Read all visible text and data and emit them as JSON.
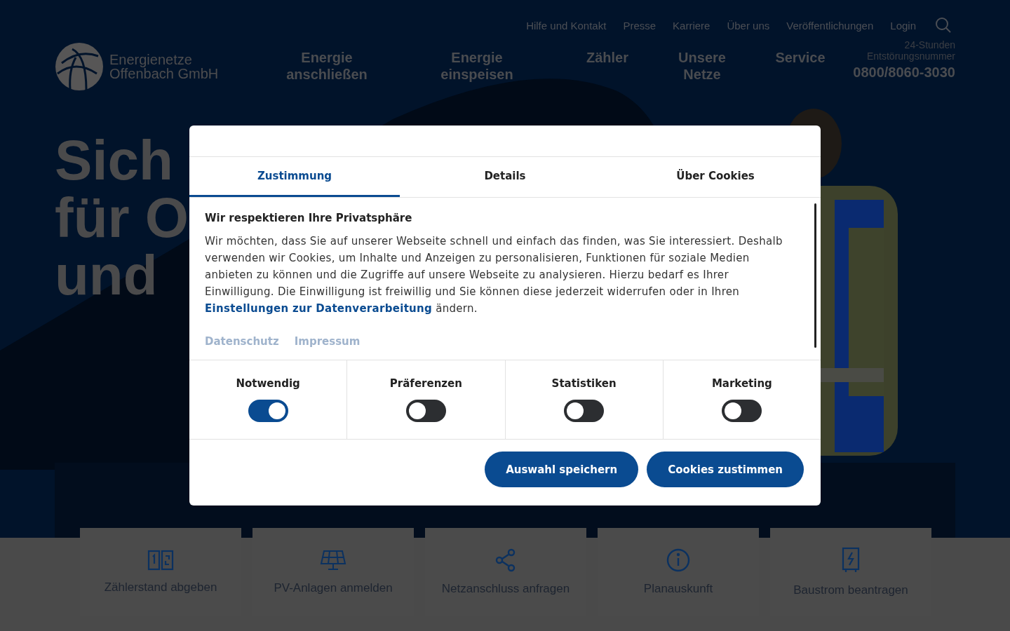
{
  "top_links": [
    "Hilfe und Kontakt",
    "Presse",
    "Karriere",
    "Über uns",
    "Veröffentlichungen",
    "Login"
  ],
  "logo": {
    "line1": "Energienetze",
    "line2": "Offenbach GmbH"
  },
  "main_nav": [
    "Energie anschließen",
    "Energie einspeisen",
    "Zähler",
    "Unsere Netze",
    "Service"
  ],
  "hotline": {
    "label_1": "24-Stunden",
    "label_2": "Entstörungsnummer",
    "number": "0800/8060-3030"
  },
  "hero": {
    "lines": [
      "Sich",
      "für O",
      "und"
    ],
    "picture": {
      "kind": "picture"
    }
  },
  "quick_links": [
    "Zählerstand abgeben",
    "PV-Anlagen anmelden",
    "Netzanschluss anfragen",
    "Planauskunft",
    "Baustrom beantragen"
  ],
  "cookie_dialog": {
    "tabs": [
      {
        "label": "Zustimmung",
        "selected": true
      },
      {
        "label": "Details",
        "selected": false
      },
      {
        "label": "Über Cookies",
        "selected": false
      }
    ],
    "heading": "Wir respektieren Ihre Privatsphäre",
    "text_before": "Wir möchten, dass Sie auf unserer Webseite schnell und einfach das finden, was Sie interessiert. Deshalb verwenden wir Cookies, um Inhalte und Anzeigen zu personalisieren, Funktionen für soziale Medien anbieten zu können und die Zugriffe auf unsere Webseite zu analysieren. Hierzu bedarf es Ihrer Einwilligung. Die Einwilligung ist freiwillig und Sie können diese jederzeit widerrufen oder in Ihren",
    "link": "Einstellungen zur Datenverarbeitung",
    "text_after": "ändern.",
    "footer_links": [
      "Datenschutz",
      "Impressum"
    ],
    "consents": [
      {
        "label": "Notwendig",
        "on": true
      },
      {
        "label": "Präferenzen",
        "on": false
      },
      {
        "label": "Statistiken",
        "on": false
      },
      {
        "label": "Marketing",
        "on": false
      }
    ],
    "buttons": [
      "Auswahl speichern",
      "Cookies zustimmen"
    ]
  }
}
